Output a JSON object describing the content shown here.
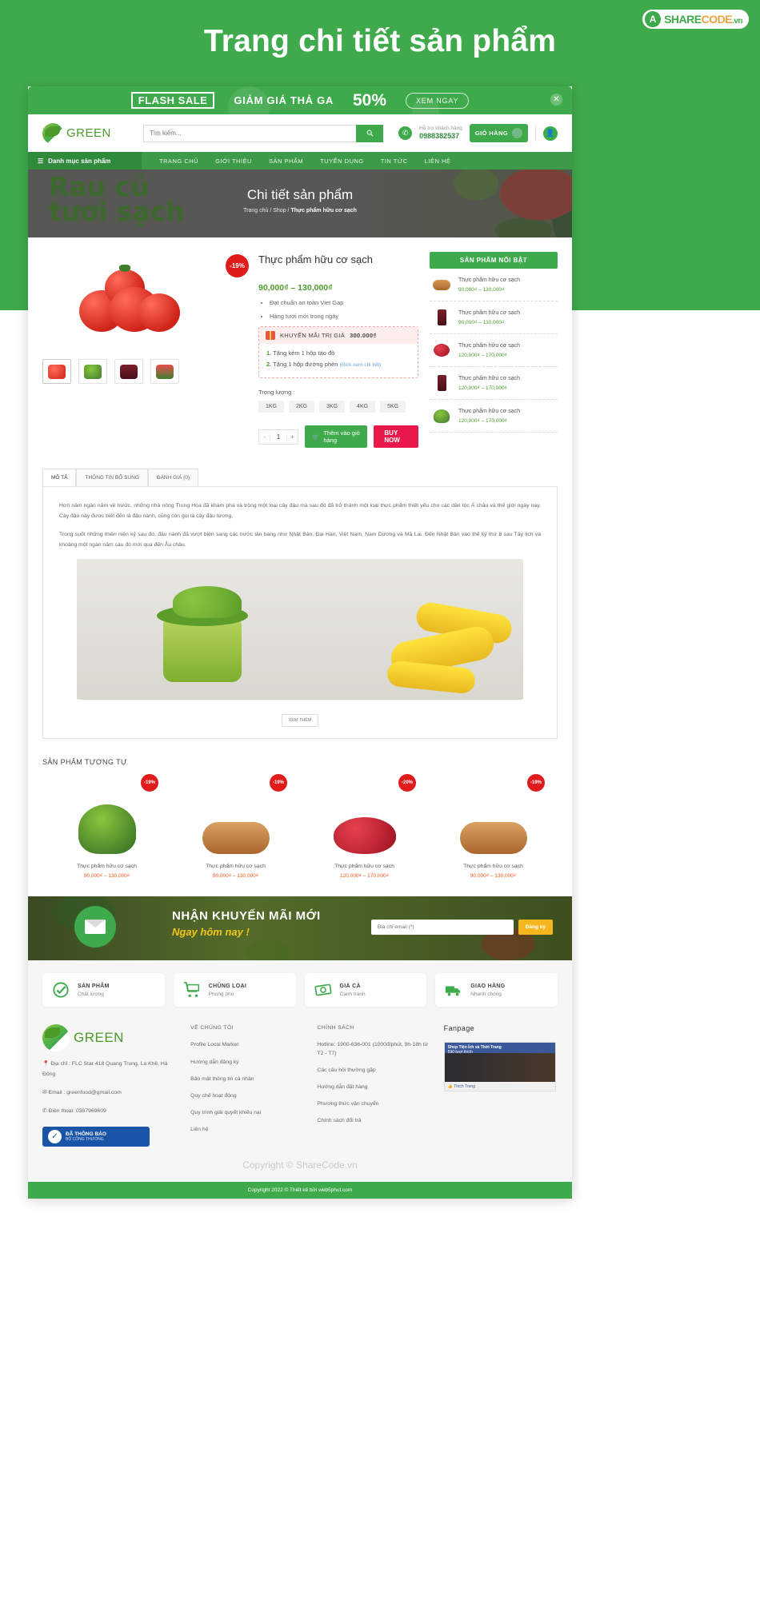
{
  "hero": {
    "title": "Trang chi tiết sản phẩm",
    "watermark_brand": {
      "share": "SHARE",
      "code": "CODE",
      "vn": ".vn"
    },
    "bg_color": "#3faa4c"
  },
  "flash_sale": {
    "tag": "FLASH SALE",
    "headline": "GIẢM GIÁ THẢ GA",
    "percent": "50%",
    "cta": "XEM NGAY",
    "close": "✕"
  },
  "header": {
    "logo_text": "GREEN",
    "search_placeholder": "Tìm kiếm...",
    "search_value": "",
    "search_icon": "search-icon",
    "support_label": "Hỗ trợ khách hàng",
    "support_phone": "0988382537",
    "cart_label": "GIỎ HÀNG",
    "cart_icon": "shopping-cart-icon",
    "account_icon": "user-icon"
  },
  "nav": {
    "category_label": "Danh mục sản phẩm",
    "hamburger_icon": "hamburger-icon",
    "items": [
      {
        "label": "TRANG CHỦ"
      },
      {
        "label": "GIỚI THIỆU"
      },
      {
        "label": "SẢN PHẨM"
      },
      {
        "label": "TUYỂN DỤNG"
      },
      {
        "label": "TIN TỨC"
      },
      {
        "label": "LIÊN HỆ"
      }
    ]
  },
  "banner": {
    "bg_text_line1": "Rau củ",
    "bg_text_line2": "tươi sạch",
    "title": "Chi tiết sản phẩm",
    "crumb_home": "Trang chủ",
    "crumb_shop": "Shop",
    "crumb_current": "Thực phẩm hữu cơ sạch",
    "sep": "/"
  },
  "product": {
    "discount_badge": "-19%",
    "title": "Thực phẩm hữu cơ sạch",
    "price": "90,000₫ – 130,000₫",
    "features": [
      "Đạt chuẩn an toàn Viet Gap",
      "Hàng tươi mới trong ngày"
    ],
    "promo": {
      "header_text": "KHUYẾN MÃI TRỊ GIÁ ",
      "header_value": "300.000₫",
      "gift_icon": "gift-icon",
      "items": [
        {
          "num": "1.",
          "text": "Tặng kèm 1 hộp táo đỏ",
          "link": ""
        },
        {
          "num": "2.",
          "text": "Tặng 1 hộp đường phèn ",
          "link": "(click xem chi tiết)"
        }
      ]
    },
    "weight_label": "Trọng lượng :",
    "weights": [
      "1KG",
      "2KG",
      "3KG",
      "4KG",
      "5KG"
    ],
    "qty_minus": "-",
    "qty_value": "1",
    "qty_plus": "+",
    "add_to_cart": "Thêm vào giỏ hàng",
    "cart_icon": "cart-icon",
    "buy_now": "BUY NOW",
    "thumbnails": [
      "tomato-thumb",
      "broccoli-thumb",
      "juice-thumb",
      "watermelon-thumb"
    ]
  },
  "sidebar": {
    "heading": "SẢN PHẨM NỔI BẬT",
    "items": [
      {
        "name": "Thực phẩm hữu cơ sạch",
        "price": "90,000₫ – 130,000₫",
        "icon": "bread-icon"
      },
      {
        "name": "Thực phẩm hữu cơ sạch",
        "price": "90,000₫ – 130,000₫",
        "icon": "juice-icon"
      },
      {
        "name": "Thực phẩm hữu cơ sạch",
        "price": "120,000₫ – 170,000₫",
        "icon": "berries-icon"
      },
      {
        "name": "Thực phẩm hữu cơ sạch",
        "price": "120,000₫ – 170,000₫",
        "icon": "juice-icon"
      },
      {
        "name": "Thực phẩm hữu cơ sạch",
        "price": "120,000₫ – 170,000₫",
        "icon": "broccoli-icon"
      }
    ]
  },
  "tabs": {
    "items": [
      {
        "label": "MÔ TẢ",
        "active": true
      },
      {
        "label": "THÔNG TIN BỔ SUNG",
        "active": false
      },
      {
        "label": "ĐÁNH GIÁ (0)",
        "active": false
      }
    ],
    "paragraphs": [
      "Hơn năm ngàn năm về trước, những nhà nông Trung Hoa đã khám phá và trồng một loại cây đậu mà sau đó đã trở thành một loại thực phẩm thiết yếu cho các dân tộc Á châu và thế giới ngày nay. Cây đậu này được biết đến là đậu nành, cũng còn gọi là cây đậu tương.",
      "Trong suốt những thiên niên kỷ sau đó, đậu nành đã vượt biên sang các nước lân bang như Nhật Bản, Đại Hàn, Việt Nam, Nam Dương và Mã Lai. Đến Nhật Bản vào thế kỷ thứ 8 sau Tây lịch và khoảng một ngàn năm sau đó mới qua đến Âu châu."
    ],
    "read_more": "XEM THÊM"
  },
  "similar": {
    "heading": "SẢN PHẨM TƯƠNG TỰ",
    "watermark": "ShareCode.vn",
    "items": [
      {
        "badge": "-19%",
        "name": "Thực phẩm hữu cơ sạch",
        "price": "90,000₫ – 130,000₫",
        "icon": "broccoli-icon"
      },
      {
        "badge": "-19%",
        "name": "Thực phẩm hữu cơ sạch",
        "price": "90,000₫ – 130,000₫",
        "icon": "bread-icon"
      },
      {
        "badge": "-20%",
        "name": "Thực phẩm hữu cơ sạch",
        "price": "120,000₫ – 170,000₫",
        "icon": "berries-icon"
      },
      {
        "badge": "-19%",
        "name": "Thực phẩm hữu cơ sạch",
        "price": "90,000₫ – 130,000₫",
        "icon": "bread-icon"
      }
    ]
  },
  "newsletter": {
    "title": "NHẬN KHUYẾN MÃI MỚI",
    "subtitle": "Ngay hôm nay !",
    "email_placeholder": "Địa chỉ email (*)",
    "email_value": "",
    "submit": "Đăng ký",
    "mail_icon": "envelope-icon"
  },
  "features": [
    {
      "title": "SẢN PHẨM",
      "sub": "Chất lượng",
      "icon": "check-circle-icon"
    },
    {
      "title": "CHỦNG LOẠI",
      "sub": "Phong phú",
      "icon": "shopping-cart-icon"
    },
    {
      "title": "GIÁ CẢ",
      "sub": "Cạnh tranh",
      "icon": "money-icon"
    },
    {
      "title": "GIAO HÀNG",
      "sub": "Nhanh chóng",
      "icon": "truck-icon"
    }
  ],
  "footer": {
    "logo_text": "GREEN",
    "address_icon": "location-pin-icon",
    "address": "Địa chỉ : FLC Star 418 Quang Trung, La Khê, Hà Đông",
    "email_icon": "mail-icon",
    "email": "Email : greenfood@gmail.com",
    "phone_icon": "phone-icon",
    "phone": "Điện thoại: 0387969609",
    "about_heading": "VỀ CHÚNG TÔI",
    "about_links": [
      "Profile Local Market",
      "Hướng dẫn đăng ký",
      "Bảo mật thông tin cá nhân",
      "Quy chế hoạt động",
      "Quy trình giải quyết khiếu nại",
      "Liên hệ"
    ],
    "policy_heading": "CHÍNH SÁCH",
    "policy_links": [
      "Hotline: 1900-636-001 (1000đ/phút, 9h-18h từ T2 - T7)",
      "Các câu hỏi thường gặp",
      "Hướng dẫn đặt hàng",
      "Phương thức vận chuyển",
      "Chính sách đổi trả"
    ],
    "fanpage_heading": "Fanpage",
    "fb_page_name": "Shop Tiện Ích và Thời Trang",
    "fb_likes": "590 lượt thích",
    "fb_like_button": "Thích Trang",
    "bct_title": "ĐÃ THÔNG BÁO",
    "bct_sub": "BỘ CÔNG THƯƠNG",
    "bct_icon": "verified-icon",
    "copyright_watermark": "Copyright © ShareCode.vn",
    "bottom_bar": "Copyright 2022 © Thiết kế bởi web5phut.com"
  }
}
